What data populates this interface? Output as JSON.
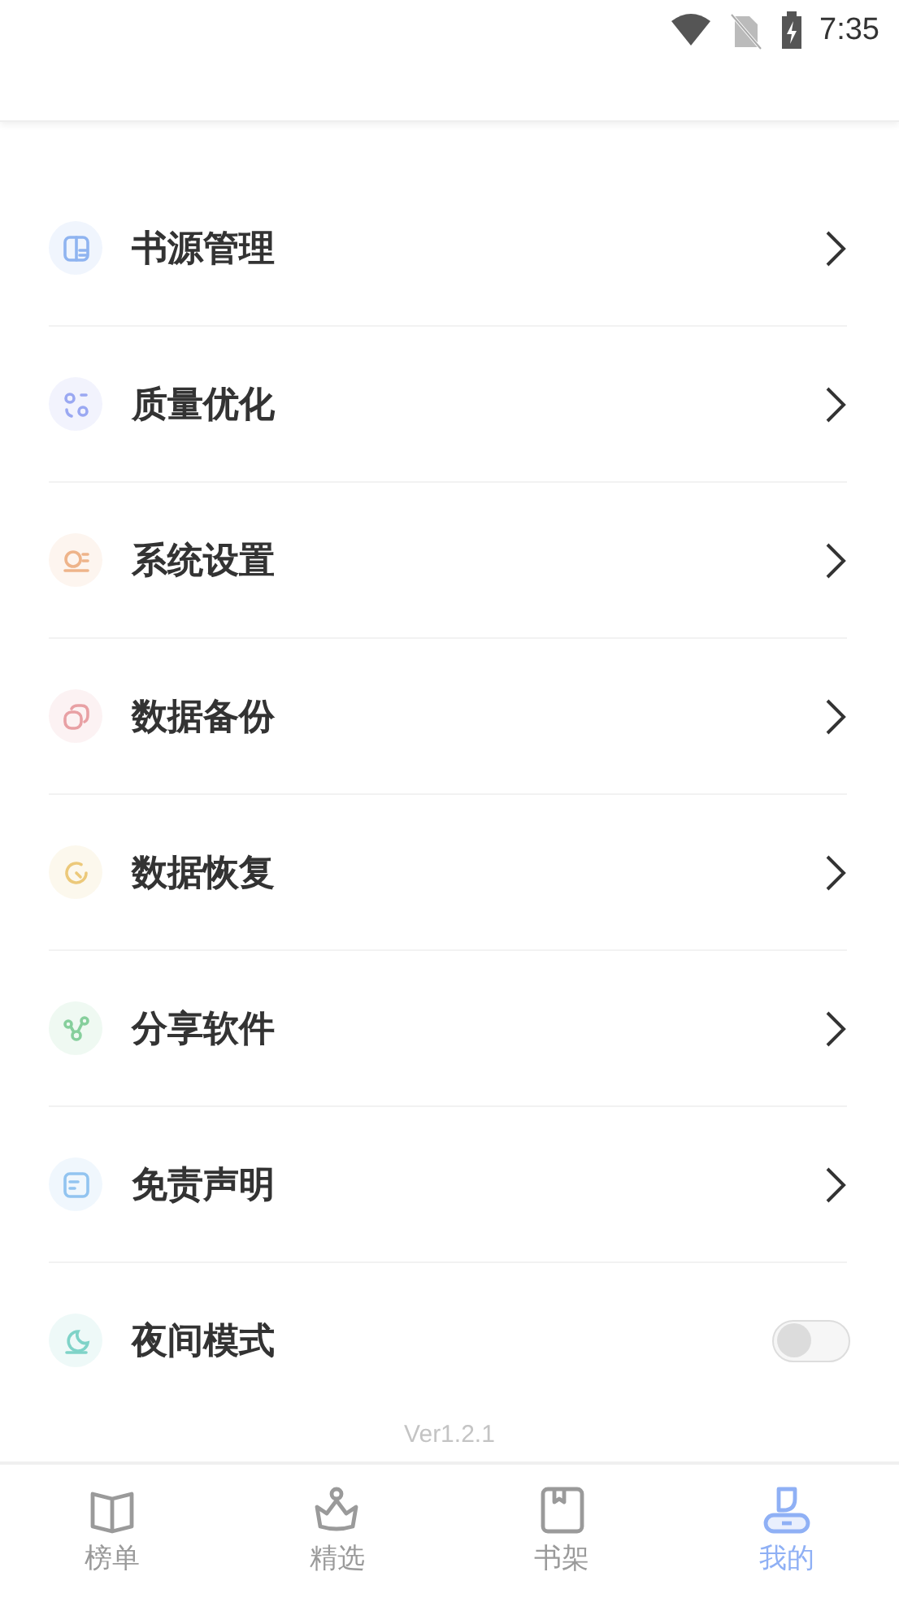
{
  "status_bar": {
    "time": "7:35"
  },
  "menu": [
    {
      "kind": "link",
      "label": "书源管理",
      "color": "#8fb4f0"
    },
    {
      "kind": "link",
      "label": "质量优化",
      "color": "#9aa8f2"
    },
    {
      "kind": "link",
      "label": "系统设置",
      "color": "#eeb48a"
    },
    {
      "kind": "link",
      "label": "数据备份",
      "color": "#e8a0a4"
    },
    {
      "kind": "link",
      "label": "数据恢复",
      "color": "#ecc97a"
    },
    {
      "kind": "link",
      "label": "分享软件",
      "color": "#86cf9c"
    },
    {
      "kind": "link",
      "label": "免责声明",
      "color": "#92c4f0"
    },
    {
      "kind": "toggle",
      "label": "夜间模式",
      "color": "#7fd3c8",
      "on": false
    }
  ],
  "version": "Ver1.2.1",
  "tabs": [
    {
      "label": "榜单",
      "selected": false
    },
    {
      "label": "精选",
      "selected": false
    },
    {
      "label": "书架",
      "selected": false
    },
    {
      "label": "我的",
      "selected": true
    }
  ]
}
